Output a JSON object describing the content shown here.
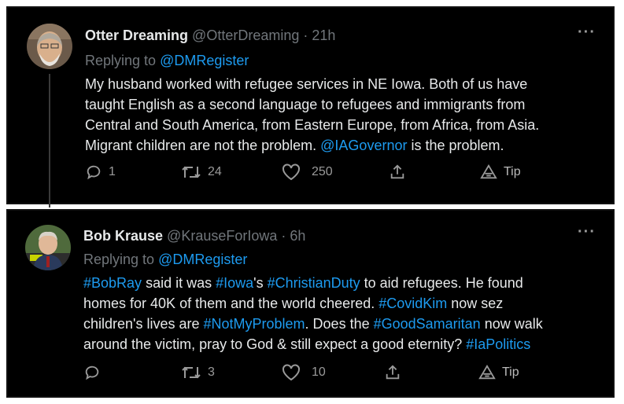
{
  "tweets": [
    {
      "name": "Otter Dreaming",
      "handle": "@OtterDreaming",
      "separator": "·",
      "time": "21h",
      "replying_prefix": "Replying to",
      "replying_to": "@DMRegister",
      "body_lines": [
        [
          {
            "t": "My husband worked with refugee services in NE Iowa. Both of us have",
            "link": false
          }
        ],
        [
          {
            "t": "taught English as a second language to refugees and immigrants from",
            "link": false
          }
        ],
        [
          {
            "t": "Central and South America, from Eastern Europe, from Africa, from Asia.",
            "link": false
          }
        ],
        [
          {
            "t": "Migrant children are not the problem. ",
            "link": false
          },
          {
            "t": "@IAGovernor",
            "link": true
          },
          {
            "t": " is the problem.",
            "link": false
          }
        ]
      ],
      "replies": "1",
      "retweets": "24",
      "likes": "250",
      "tip_label": "Tip"
    },
    {
      "name": "Bob Krause",
      "handle": "@KrauseForIowa",
      "separator": "·",
      "time": "6h",
      "replying_prefix": "Replying to",
      "replying_to": "@DMRegister",
      "body_lines": [
        [
          {
            "t": "#BobRay",
            "link": true
          },
          {
            "t": " said it was ",
            "link": false
          },
          {
            "t": "#Iowa",
            "link": true
          },
          {
            "t": "'s ",
            "link": false
          },
          {
            "t": "#ChristianDuty",
            "link": true
          },
          {
            "t": " to aid refugees. He found",
            "link": false
          }
        ],
        [
          {
            "t": "homes for 40K of them and the world cheered. ",
            "link": false
          },
          {
            "t": "#CovidKim",
            "link": true
          },
          {
            "t": " now sez",
            "link": false
          }
        ],
        [
          {
            "t": "children's lives are ",
            "link": false
          },
          {
            "t": "#NotMyProblem",
            "link": true
          },
          {
            "t": ". Does the ",
            "link": false
          },
          {
            "t": "#GoodSamaritan",
            "link": true
          },
          {
            "t": " now walk",
            "link": false
          }
        ],
        [
          {
            "t": "around the victim, pray to God & still expect a good eternity? ",
            "link": false
          },
          {
            "t": "#IaPolitics",
            "link": true
          }
        ]
      ],
      "replies": "",
      "retweets": "3",
      "likes": "10",
      "tip_label": "Tip"
    }
  ],
  "icons": {
    "more": "more-horizontal-icon",
    "reply": "reply-bubble-icon",
    "retweet": "retweet-icon",
    "like": "heart-icon",
    "share": "share-upload-icon",
    "tip": "tip-icon"
  },
  "colors": {
    "background": "#000000",
    "text": "#e7e9ea",
    "muted": "#71767b",
    "link": "#1d9bf0",
    "action": "#9a9a9a"
  }
}
